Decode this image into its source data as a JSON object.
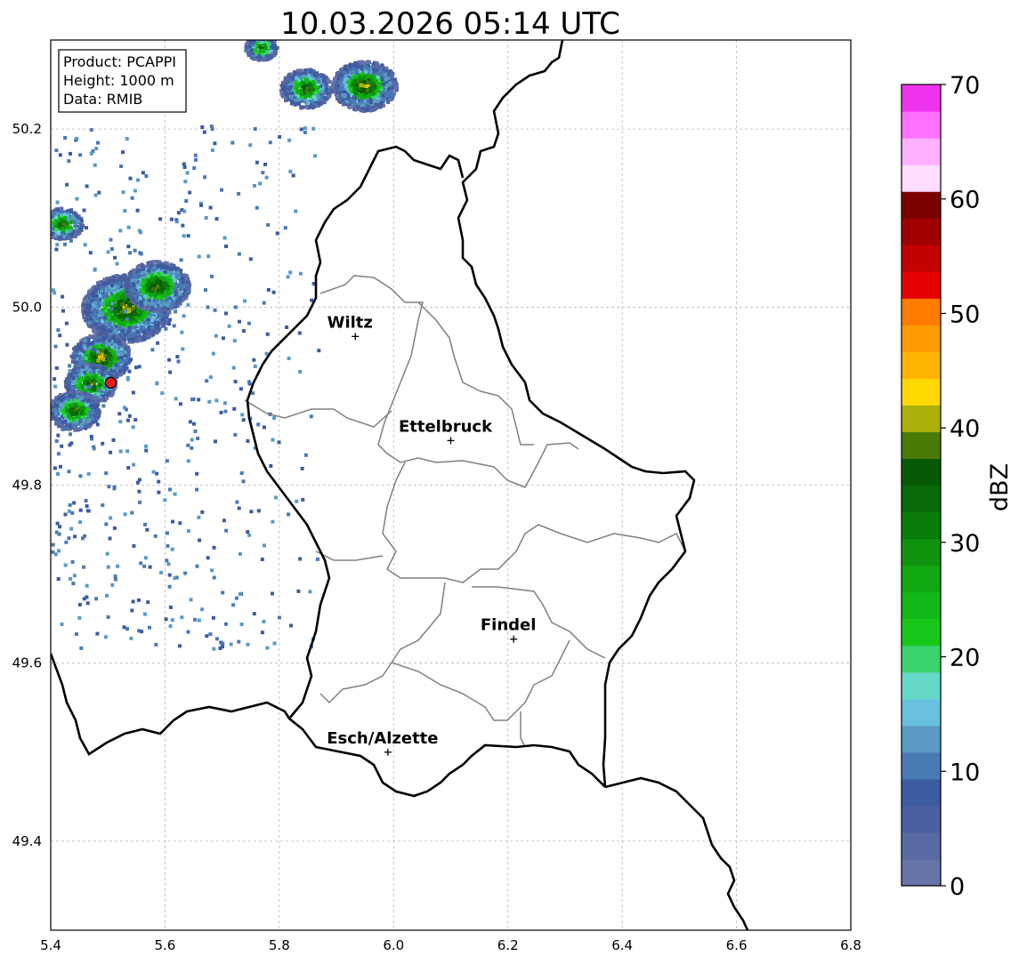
{
  "title": "10.03.2026 05:14 UTC",
  "info_box": {
    "product": "Product: PCAPPI",
    "height": "Height: 1000 m",
    "data": "Data: RMIB"
  },
  "map": {
    "lon_range": [
      5.4,
      6.8
    ],
    "lat_range": [
      49.3,
      50.3
    ],
    "x_ticks": [
      "5.4",
      "5.6",
      "5.8",
      "6.0",
      "6.2",
      "6.4",
      "6.6",
      "6.8"
    ],
    "y_ticks": [
      "49.4",
      "49.6",
      "49.8",
      "50.0",
      "50.2"
    ],
    "grid": true,
    "radar_site": {
      "lon": 5.505,
      "lat": 49.915,
      "color": "#e02020"
    },
    "cities": [
      {
        "name": "Wiltz",
        "lon": 5.933,
        "lat": 49.967
      },
      {
        "name": "Ettelbruck",
        "lon": 6.1,
        "lat": 49.85
      },
      {
        "name": "Findel",
        "lon": 6.21,
        "lat": 49.627
      },
      {
        "name": "Esch/Alzette",
        "lon": 5.99,
        "lat": 49.5
      }
    ]
  },
  "colorbar": {
    "label": "dBZ",
    "min": 0,
    "max": 70,
    "tick_labels": [
      "0",
      "10",
      "20",
      "30",
      "40",
      "50",
      "60",
      "70"
    ],
    "colors": [
      "#6674a8",
      "#5a6aa4",
      "#4a5fa0",
      "#3d5ba0",
      "#4a7ab3",
      "#5a9ac5",
      "#66c0de",
      "#66d8c8",
      "#3ad46c",
      "#18c818",
      "#10b818",
      "#12a812",
      "#109410",
      "#0a7c0a",
      "#086a08",
      "#065a06",
      "#4a7a06",
      "#aab008",
      "#ffd800",
      "#ffb400",
      "#ff9a00",
      "#ff7c00",
      "#e60000",
      "#c40000",
      "#a00000",
      "#7a0000",
      "#ffddff",
      "#ffb0ff",
      "#ff70ff",
      "#ee33ee"
    ]
  }
}
